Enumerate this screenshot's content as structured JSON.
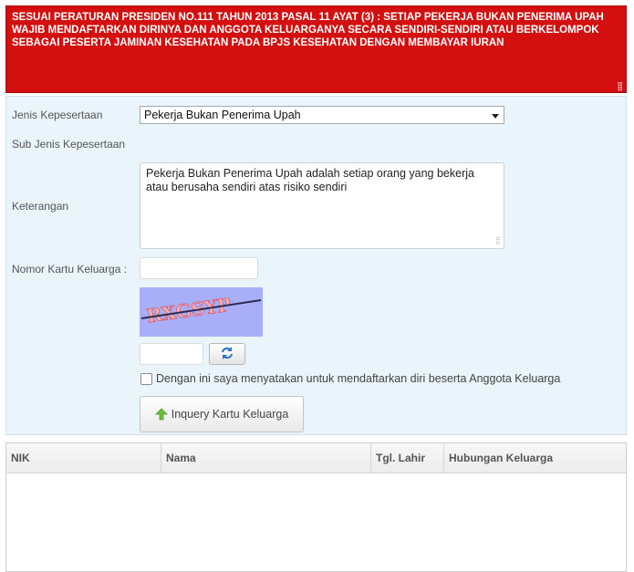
{
  "notice": {
    "text": "SESUAI PERATURAN PRESIDEN NO.111 TAHUN 2013 PASAL 11 AYAT (3) : SETIAP PEKERJA BUKAN PENERIMA UPAH WAJIB MENDAFTARKAN DIRINYA DAN ANGGOTA KELUARGANYA SECARA SENDIRI-SENDIRI ATAU BERKELOMPOK SEBAGAI PESERTA JAMINAN KESEHATAN PADA BPJS KESEHATAN DENGAN MEMBAYAR IURAN"
  },
  "form": {
    "jenis_label": "Jenis Kepesertaan",
    "jenis_value": "Pekerja Bukan Penerima Upah",
    "sub_jenis_label": "Sub Jenis Kepesertaan",
    "keterangan_label": "Keterangan",
    "keterangan_value": "Pekerja Bukan Penerima Upah adalah setiap orang yang bekerja atau berusaha sendiri atas risiko sendiri",
    "nomor_kk_label": "Nomor Kartu Keluarga :",
    "nomor_kk_value": "",
    "captcha_value": "",
    "captcha_image_text": "RXGSYP",
    "agree_label": "Dengan ini saya menyatakan untuk mendaftarkan diri beserta Anggota Keluarga",
    "agree_checked": false,
    "inquiry_label": "Inquery Kartu Keluarga"
  },
  "table": {
    "columns": [
      "NIK",
      "Nama",
      "Tgl. Lahir",
      "Hubungan Keluarga"
    ],
    "rows": []
  },
  "colors": {
    "notice_bg": "#d30f0f",
    "panel_bg": "#e9f4fb",
    "refresh_icon": "#2b6fd6",
    "inquiry_icon": "#6cbf3a"
  },
  "icons": {
    "refresh": "refresh-icon",
    "inquiry": "up-arrow-icon",
    "select": "chevron-down-icon"
  }
}
